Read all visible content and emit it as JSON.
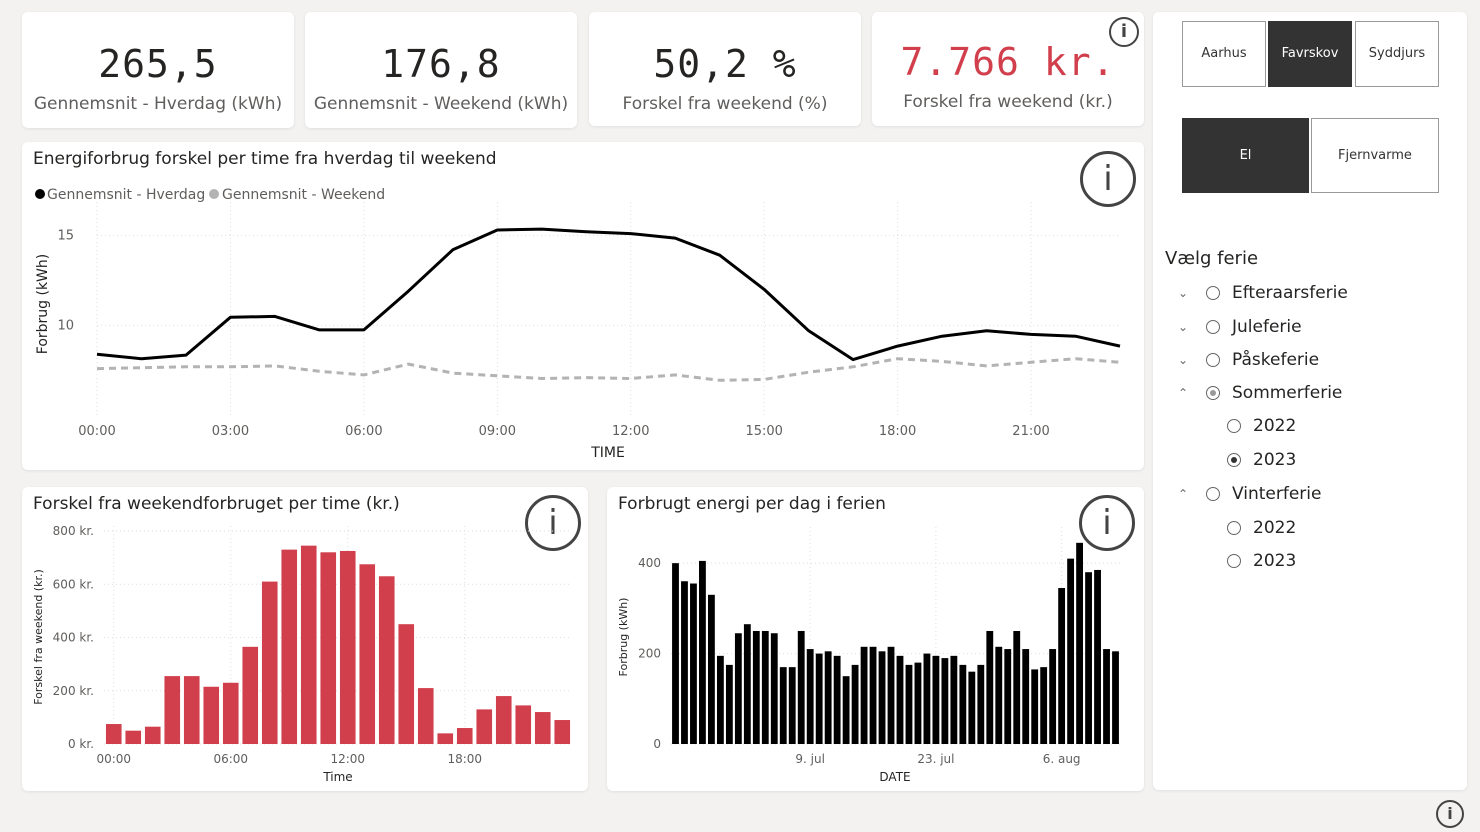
{
  "kpis": [
    {
      "value": "265,5",
      "label": "Gennemsnit - Hverdag (kWh)",
      "color": "#252423"
    },
    {
      "value": "176,8",
      "label": "Gennemsnit - Weekend (kWh)",
      "color": "#252423"
    },
    {
      "value": "50,2 %",
      "label": "Forskel fra weekend (%)",
      "color": "#252423"
    },
    {
      "value": "7.766 kr.",
      "label": "Forskel fra weekend (kr.)",
      "color": "#d13f4c"
    }
  ],
  "info_glyph": "i",
  "line_chart": {
    "title": "Energiforbrug forskel per time fra hverdag til weekend",
    "legend": [
      "Gennemsnit - Hverdag",
      "Gennemsnit - Weekend"
    ],
    "ylabel": "Forbrug (kWh)",
    "xlabel": "TIME"
  },
  "bar_chart_hour": {
    "title": "Forskel fra weekendforbruget per time (kr.)",
    "ylabel": "Forskel fra weekend (kr.)",
    "xlabel": "Time"
  },
  "bar_chart_day": {
    "title": "Forbrugt energi per dag i ferien",
    "ylabel": "Forbrug (kWh)",
    "xlabel": "DATE"
  },
  "city_slicer": [
    {
      "label": "Aarhus",
      "active": false
    },
    {
      "label": "Favrskov",
      "active": true
    },
    {
      "label": "Syddjurs",
      "active": false
    }
  ],
  "energy_slicer": [
    {
      "label": "El",
      "active": true
    },
    {
      "label": "Fjernvarme",
      "active": false
    }
  ],
  "holiday_slicer": {
    "title": "Vælg ferie",
    "items": [
      {
        "label": "Efteraarsferie",
        "chevron": "⌄",
        "state": "off",
        "level": 0
      },
      {
        "label": "Juleferie",
        "chevron": "⌄",
        "state": "off",
        "level": 0
      },
      {
        "label": "Påskeferie",
        "chevron": "⌄",
        "state": "off",
        "level": 0
      },
      {
        "label": "Sommerferie",
        "chevron": "⌃",
        "state": "half",
        "level": 0
      },
      {
        "label": "2022",
        "chevron": "",
        "state": "off",
        "level": 1
      },
      {
        "label": "2023",
        "chevron": "",
        "state": "on",
        "level": 1
      },
      {
        "label": "Vinterferie",
        "chevron": "⌃",
        "state": "off",
        "level": 0
      },
      {
        "label": "2022",
        "chevron": "",
        "state": "off",
        "level": 1
      },
      {
        "label": "2023",
        "chevron": "",
        "state": "off",
        "level": 1
      }
    ]
  },
  "chart_data": [
    {
      "type": "line",
      "x": [
        "00:00",
        "01:00",
        "02:00",
        "03:00",
        "04:00",
        "05:00",
        "06:00",
        "07:00",
        "08:00",
        "09:00",
        "10:00",
        "11:00",
        "12:00",
        "13:00",
        "14:00",
        "15:00",
        "16:00",
        "17:00",
        "18:00",
        "19:00",
        "20:00",
        "21:00",
        "22:00",
        "23:00"
      ],
      "xticks": [
        "00:00",
        "03:00",
        "06:00",
        "09:00",
        "12:00",
        "15:00",
        "18:00",
        "21:00"
      ],
      "yticks": [
        10,
        15
      ],
      "ylim": [
        5.3,
        16.3
      ],
      "series": [
        {
          "name": "Gennemsnit - Hverdag",
          "color": "#000000",
          "dashed": false,
          "values": [
            8.4,
            8.15,
            8.35,
            10.45,
            10.5,
            9.75,
            9.75,
            11.9,
            14.2,
            15.3,
            15.35,
            15.2,
            15.1,
            14.85,
            13.9,
            12.0,
            9.7,
            8.1,
            8.85,
            9.4,
            9.7,
            9.5,
            9.4,
            8.85
          ]
        },
        {
          "name": "Gennemsnit - Weekend",
          "color": "#b3b3b3",
          "dashed": true,
          "values": [
            7.6,
            7.65,
            7.7,
            7.7,
            7.75,
            7.45,
            7.25,
            7.85,
            7.35,
            7.2,
            7.05,
            7.1,
            7.05,
            7.25,
            6.95,
            7.0,
            7.4,
            7.7,
            8.15,
            8.0,
            7.75,
            7.95,
            8.15,
            7.95
          ]
        }
      ]
    },
    {
      "type": "bar",
      "x": [
        "00:00",
        "01:00",
        "02:00",
        "03:00",
        "04:00",
        "05:00",
        "06:00",
        "07:00",
        "08:00",
        "09:00",
        "10:00",
        "11:00",
        "12:00",
        "13:00",
        "14:00",
        "15:00",
        "16:00",
        "17:00",
        "18:00",
        "19:00",
        "20:00",
        "21:00",
        "22:00",
        "23:00"
      ],
      "values": [
        75,
        50,
        65,
        255,
        255,
        215,
        230,
        365,
        610,
        730,
        745,
        720,
        725,
        675,
        630,
        450,
        210,
        40,
        60,
        130,
        180,
        145,
        120,
        90
      ],
      "xticks": [
        "00:00",
        "06:00",
        "12:00",
        "18:00"
      ],
      "yticks": [
        0,
        200,
        400,
        600,
        800
      ],
      "ytick_labels": [
        "0 kr.",
        "200 kr.",
        "400 kr.",
        "600 kr.",
        "800 kr."
      ],
      "ylim": [
        0,
        800
      ],
      "color": "#d13f4c"
    },
    {
      "type": "bar",
      "x_start": "2023-06-24",
      "values": [
        400,
        360,
        355,
        405,
        330,
        195,
        175,
        245,
        265,
        250,
        250,
        245,
        170,
        170,
        250,
        210,
        200,
        205,
        195,
        150,
        175,
        215,
        215,
        205,
        215,
        195,
        175,
        180,
        200,
        195,
        190,
        195,
        175,
        160,
        175,
        250,
        215,
        210,
        250,
        210,
        165,
        170,
        210,
        345,
        410,
        445,
        380,
        385,
        210,
        205
      ],
      "xticks": [
        "9. jul",
        "23. jul",
        "6. aug"
      ],
      "yticks": [
        0,
        200,
        400
      ],
      "ylim": [
        0,
        480
      ],
      "color": "#000000"
    }
  ]
}
